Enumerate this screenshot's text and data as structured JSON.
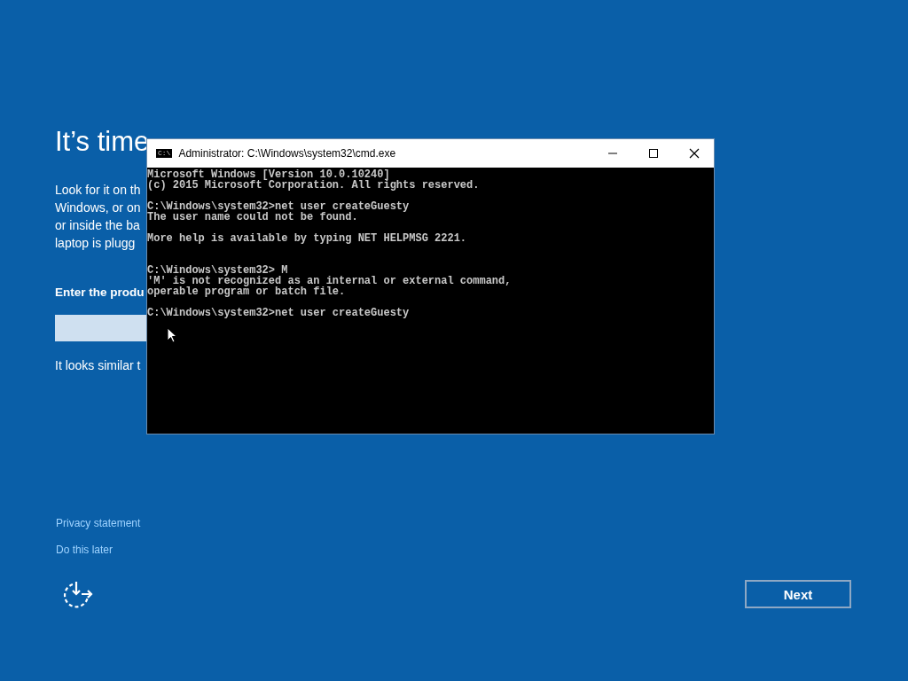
{
  "setup": {
    "heading": "It’s time",
    "description_lines": [
      "Look for it on th",
      "Windows, or on",
      "or inside the ba",
      "laptop is plugg"
    ],
    "field_label": "Enter the produ",
    "hint": "It looks similar t",
    "links": [
      "Privacy statement",
      "Do this later"
    ],
    "next_button": "Next"
  },
  "console_window": {
    "title": "Administrator: C:\\Windows\\system32\\cmd.exe",
    "icon_text": "C:\\",
    "output": "Microsoft Windows [Version 10.0.10240]\n(c) 2015 Microsoft Corporation. All rights reserved.\n\nC:\\Windows\\system32>net user createGuesty\nThe user name could not be found.\n\nMore help is available by typing NET HELPMSG 2221.\n\n\nC:\\Windows\\system32> M\n'M' is not recognized as an internal or external command,\noperable program or batch file.\n\nC:\\Windows\\system32>net user createGuesty"
  }
}
